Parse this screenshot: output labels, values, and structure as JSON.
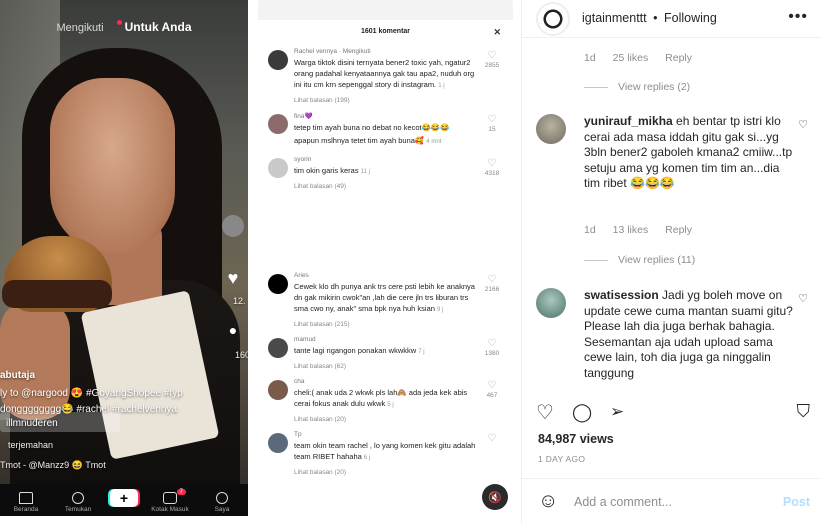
{
  "tiktok": {
    "tab_following": "Mengikuti",
    "tab_foryou": "Untuk Anda",
    "username_partial": "abutaja",
    "caption_line1": "ly to @nargood 😍 #GoyangShopee #fyp",
    "caption_line2": "dongggggggg😂 #rachel #rachelvennya",
    "caption_line3": "illmnuderen",
    "translate": "terjemahan",
    "sound": "Tmot - @Manzz9 😆 Tmot",
    "likes_partial": "12.",
    "comments_partial": "160",
    "nav": [
      {
        "label": "Beranda"
      },
      {
        "label": "Temukan"
      },
      {
        "label": "+"
      },
      {
        "label": "Kotak Masuk",
        "badge": "7"
      },
      {
        "label": "Saya"
      }
    ]
  },
  "comments_panel_1": {
    "header": "1601 komentar",
    "close": "✕",
    "items": [
      {
        "user": "Rachel vennya · Mengikuti",
        "text": "Warga tiktok disini ternyata bener2 toxic yah, ngatur2 orang padahal kenyataannya gak tau apa2, nuduh org ini itu cm krn sepenggal story di instagram.",
        "time": "1 j",
        "replies": "Lihat balasan (199)",
        "likes": "2855",
        "avatar_color": "#3a3a3a"
      },
      {
        "user": "fina💜",
        "text": "tetep tim ayah buna no debat no kecot😂😂😂",
        "time": "",
        "replies": "",
        "likes": "15",
        "avatar_color": "#8b6b6b"
      },
      {
        "user": "",
        "text": "apapun mslhnya tetet tim ayah buna🥰",
        "time": "4 mnt",
        "replies": "",
        "likes": "",
        "avatar_color": ""
      },
      {
        "user": "syorin",
        "text": "tim okin garis keras",
        "time": "11 j",
        "replies": "Lihat balasan (49)",
        "likes": "4318",
        "avatar_color": "#c9c9c9"
      }
    ]
  },
  "comments_panel_2": {
    "items": [
      {
        "user": "Aries",
        "text": "Cewek klo dh punya ank trs cere psti lebih ke anaknya dn gak mikirin cwok\"an ,lah die cere jln trs liburan trs sma cwo ny, anak\" sma bpk nya huh ksian",
        "time": "9 j",
        "replies": "Lihat balasan (215)",
        "likes": "2166",
        "avatar_color": "#000000"
      },
      {
        "user": "mamud",
        "text": "tante lagi ngangon ponakan wkwkkw",
        "time": "7 j",
        "replies": "Lihat balasan (62)",
        "likes": "1380",
        "avatar_color": "#4a4a4a"
      },
      {
        "user": "cha",
        "text": "cheli:( anak uda 2 wkwk pls lah🙈 ada jeda kek abis cerai fokus anak dulu wkwk",
        "time": "5 j",
        "replies": "Lihat balasan (20)",
        "likes": "467",
        "avatar_color": "#7a5a4a"
      },
      {
        "user": "Tp",
        "text": "team okin team rachel , lo yang komen kek gitu adalah team RIBET hahaha",
        "time": "6 j",
        "replies": "Lihat balasan (20)",
        "likes": "",
        "avatar_color": "#5a6a7a"
      }
    ],
    "mute_icon": "🔇"
  },
  "instagram": {
    "username": "igtainmenttt",
    "separator": "•",
    "follow_status": "Following",
    "more": "•••",
    "top_meta": {
      "time": "1d",
      "likes": "25 likes",
      "reply": "Reply"
    },
    "top_view_replies": "View replies (2)",
    "comments": [
      {
        "user": "yunirauf_mikha",
        "text": "eh bentar tp istri klo cerai ada masa iddah gitu gak si...yg 3bln bener2 gaboleh kmana2 cmiiw...tp setuju ama yg komen tim tim an...dia tim ribet 😂😂😂",
        "time": "1d",
        "likes": "13 likes",
        "reply": "Reply",
        "view_replies": "View replies (11)",
        "avatar_color": "#8a8a7a"
      },
      {
        "user": "swatisession",
        "text": "Jadi yg boleh move on update cewe cuma mantan suami gitu? Please lah dia juga berhak bahagia. Sesemantan aja udah upload sama cewe lain, toh dia juga ga ninggalin tanggung",
        "time": "",
        "likes": "",
        "reply": "",
        "view_replies": "",
        "avatar_color": "#6f8f8a"
      }
    ],
    "views": "84,987 views",
    "date": "1 DAY AGO",
    "add_comment_placeholder": "Add a comment...",
    "post_label": "Post"
  }
}
